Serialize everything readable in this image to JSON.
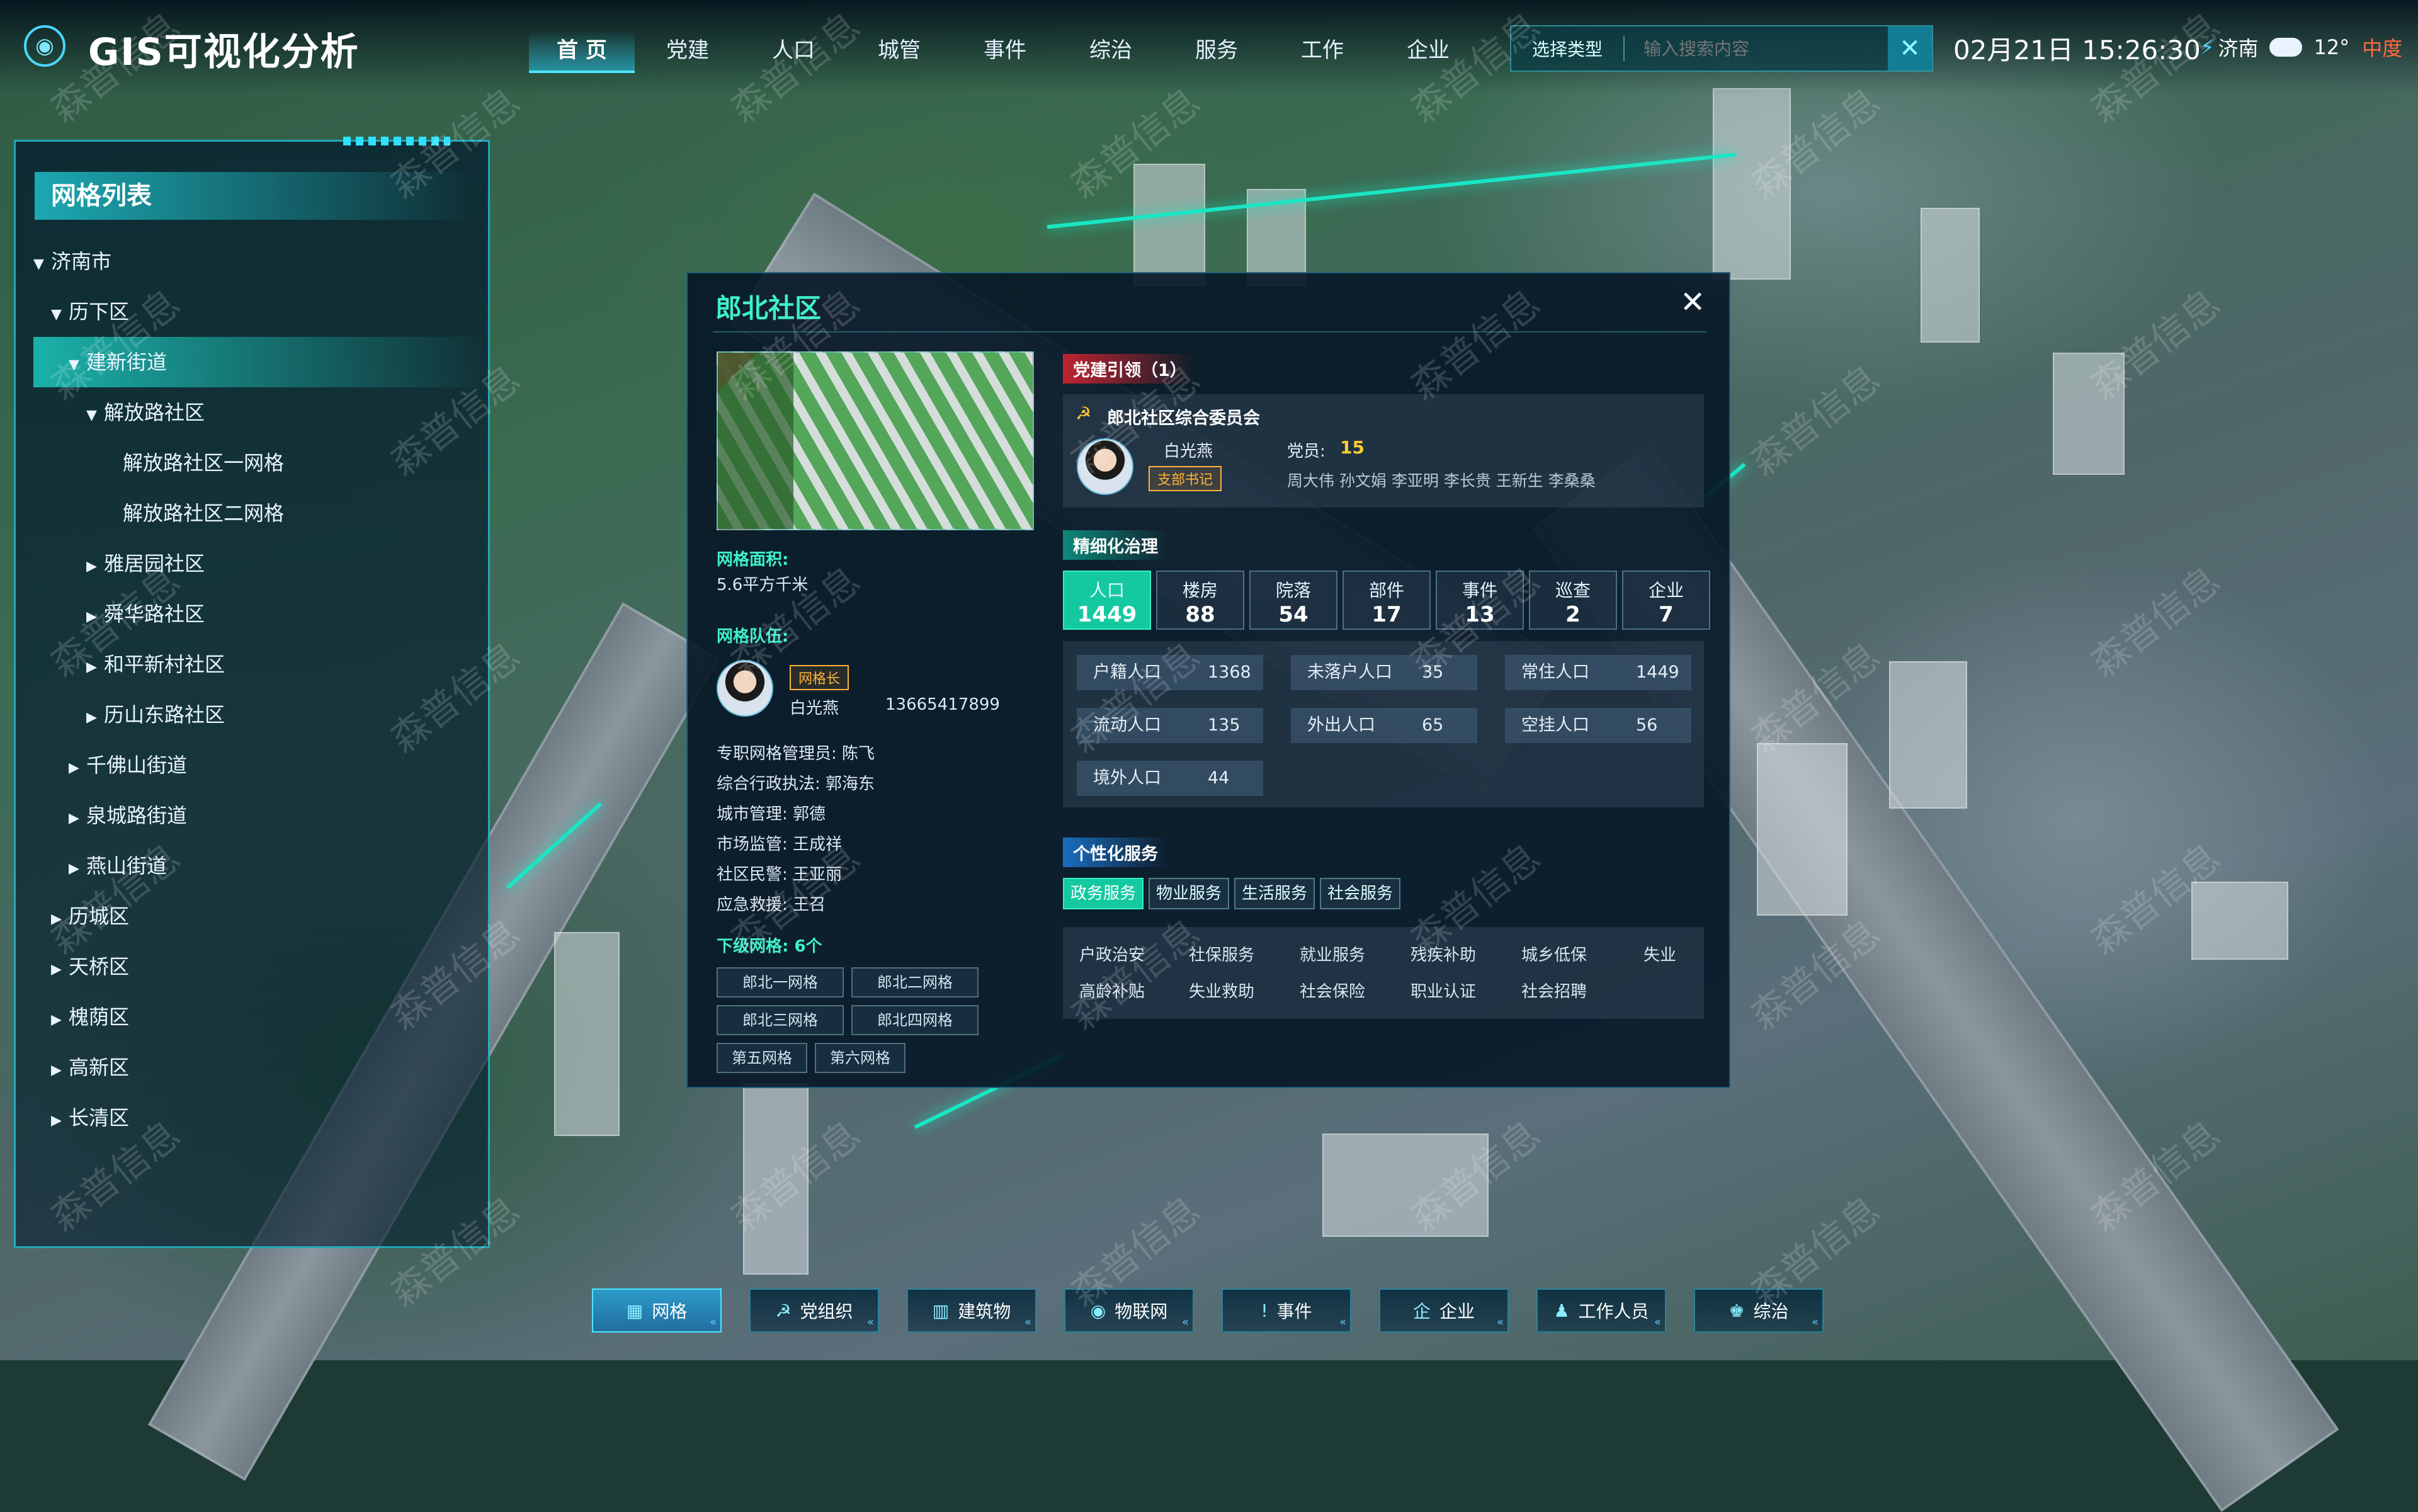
{
  "header": {
    "title": "GIS可视化分析",
    "nav": [
      "首 页",
      "党建",
      "人口",
      "城管",
      "事件",
      "综治",
      "服务",
      "工作",
      "企业"
    ],
    "active_nav": 0,
    "search_type": "选择类型",
    "search_placeholder": "输入搜索内容",
    "datetime": "02月21日 15:26:30",
    "city": "济南",
    "temperature": "12°",
    "aqi": "中度"
  },
  "sidebar": {
    "title": "网格列表",
    "tree": [
      {
        "label": "济南市",
        "level": 0,
        "expanded": true
      },
      {
        "label": "历下区",
        "level": 1,
        "expanded": true
      },
      {
        "label": "建新街道",
        "level": 2,
        "expanded": true,
        "selected": true
      },
      {
        "label": "解放路社区",
        "level": 3,
        "expanded": true
      },
      {
        "label": "解放路社区一网格",
        "level": 4
      },
      {
        "label": "解放路社区二网格",
        "level": 4
      },
      {
        "label": "雅居园社区",
        "level": 3,
        "expanded": false
      },
      {
        "label": "舜华路社区",
        "level": 3,
        "expanded": false
      },
      {
        "label": "和平新村社区",
        "level": 3,
        "expanded": false
      },
      {
        "label": "历山东路社区",
        "level": 3,
        "expanded": false
      },
      {
        "label": "千佛山街道",
        "level": 2,
        "expanded": false
      },
      {
        "label": "泉城路街道",
        "level": 2,
        "expanded": false
      },
      {
        "label": "燕山街道",
        "level": 2,
        "expanded": false
      },
      {
        "label": "历城区",
        "level": 1,
        "expanded": false
      },
      {
        "label": "天桥区",
        "level": 1,
        "expanded": false
      },
      {
        "label": "槐荫区",
        "level": 1,
        "expanded": false
      },
      {
        "label": "高新区",
        "level": 1,
        "expanded": false
      },
      {
        "label": "长清区",
        "level": 1,
        "expanded": false
      }
    ]
  },
  "popup": {
    "title": "郎北社区",
    "area_label": "网格面积:",
    "area_value": "5.6平方千米",
    "team_label": "网格队伍:",
    "leader_tag": "网格长",
    "leader_name": "白光燕",
    "leader_phone": "13665417899",
    "staff": [
      "专职网格管理员: 陈飞",
      "综合行政执法: 郭海东",
      "城市管理: 郭德",
      "市场监管: 王成祥",
      "社区民警: 王亚丽",
      "应急救援: 王召"
    ],
    "sub_label": "下级网格: 6个",
    "sub_grids": [
      "郎北一网格",
      "郎北二网格",
      "郎北三网格",
      "郎北四网格",
      "第五网格",
      "第六网格"
    ],
    "party_section": "党建引领（1）",
    "party_org": "郎北社区综合委员会",
    "party_secretary": "白光燕",
    "party_secretary_tag": "支部书记",
    "party_members_label": "党员:",
    "party_members_count": "15",
    "party_members": "周大伟 孙文娟 李亚明 李长贵 王新生 李桑桑",
    "governance_section": "精细化治理",
    "gov_tabs": [
      {
        "name": "人口",
        "value": "1449",
        "active": true
      },
      {
        "name": "楼房",
        "value": "88"
      },
      {
        "name": "院落",
        "value": "54"
      },
      {
        "name": "部件",
        "value": "17"
      },
      {
        "name": "事件",
        "value": "13"
      },
      {
        "name": "巡查",
        "value": "2"
      },
      {
        "name": "企业",
        "value": "7"
      }
    ],
    "population": [
      {
        "k": "户籍人口",
        "v": "1368"
      },
      {
        "k": "未落户人口",
        "v": "35"
      },
      {
        "k": "常住人口",
        "v": "1449"
      },
      {
        "k": "流动人口",
        "v": "135"
      },
      {
        "k": "外出人口",
        "v": "65"
      },
      {
        "k": "空挂人口",
        "v": "56"
      },
      {
        "k": "境外人口",
        "v": "44"
      }
    ],
    "service_section": "个性化服务",
    "service_tabs": [
      "政务服务",
      "物业服务",
      "生活服务",
      "社会服务"
    ],
    "services": [
      "户政治安",
      "社保服务",
      "就业服务",
      "残疾补助",
      "城乡低保",
      "失业",
      "高龄补贴",
      "失业救助",
      "社会保险",
      "职业认证",
      "社会招聘"
    ]
  },
  "toolbar": [
    {
      "label": "网格",
      "icon": "grid-icon",
      "active": true
    },
    {
      "label": "党组织",
      "icon": "party-icon"
    },
    {
      "label": "建筑物",
      "icon": "building-icon"
    },
    {
      "label": "物联网",
      "icon": "location-icon"
    },
    {
      "label": "事件",
      "icon": "alert-icon"
    },
    {
      "label": "企业",
      "icon": "enterprise-icon"
    },
    {
      "label": "工作人员",
      "icon": "staff-icon"
    },
    {
      "label": "综治",
      "icon": "governance-icon"
    }
  ],
  "watermark": "森普信息"
}
